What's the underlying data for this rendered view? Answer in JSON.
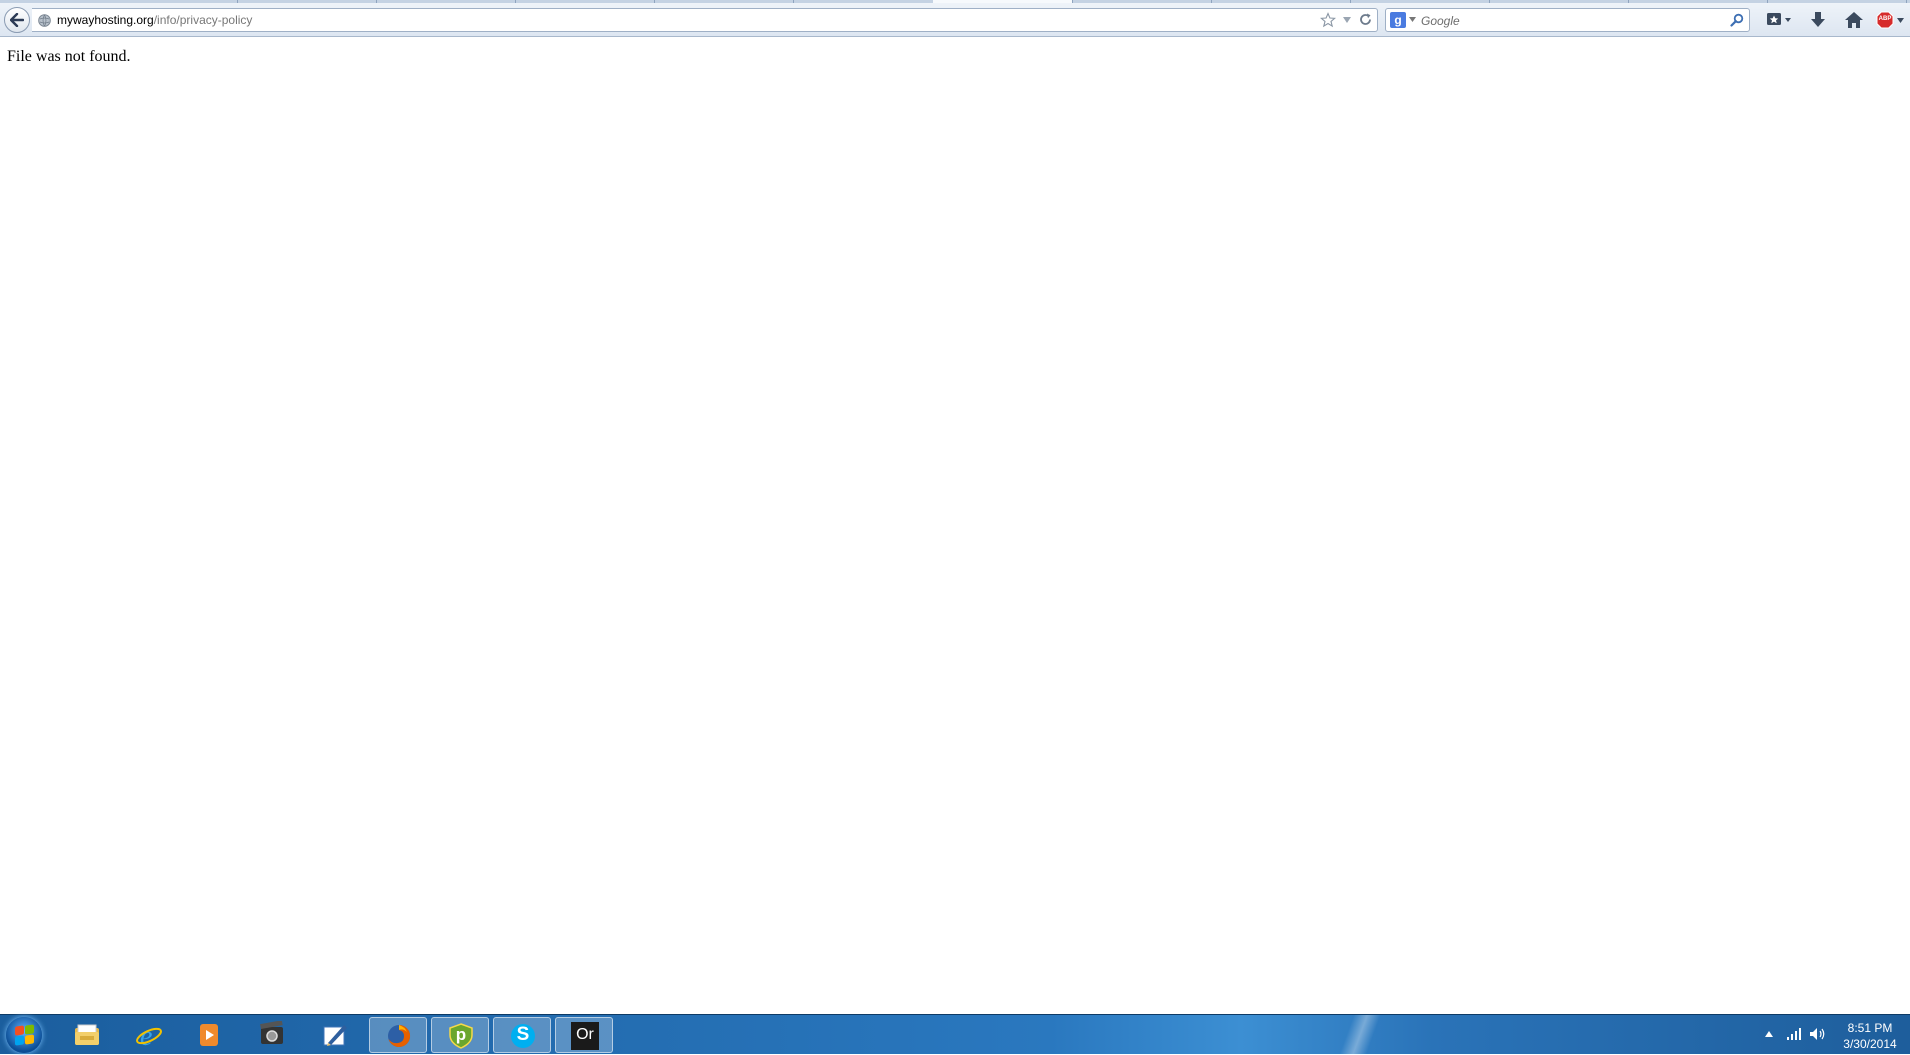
{
  "browser": {
    "url_domain": "mywayhosting.org",
    "url_path": "/info/privacy-policy",
    "search": {
      "engine_letter": "g",
      "placeholder": "Google"
    },
    "adblock_badge": "ABP"
  },
  "page": {
    "message": "File was not found."
  },
  "taskbar": {
    "apps": [
      {
        "name": "Windows Explorer",
        "icon": "folder-icon"
      },
      {
        "name": "Internet Explorer",
        "icon": "ie-icon"
      },
      {
        "name": "Media Player",
        "icon": "media-player-icon"
      },
      {
        "name": "Movie Maker",
        "icon": "movie-maker-icon"
      },
      {
        "name": "Editor",
        "icon": "pen-icon"
      },
      {
        "name": "Firefox",
        "icon": "firefox-icon"
      },
      {
        "name": "Security",
        "icon": "shield-icon"
      },
      {
        "name": "Skype",
        "icon": "skype-icon"
      },
      {
        "name": "Origin",
        "icon": "origin-icon"
      }
    ],
    "origin_label": "Or",
    "skype_letter": "S",
    "shield_letter": "p",
    "clock_time": "8:51 PM",
    "clock_date": "3/30/2014"
  },
  "colors": {
    "taskbar": "#2a78bf",
    "adblock": "#d62b2b",
    "google_icon": "#4a7be0"
  }
}
